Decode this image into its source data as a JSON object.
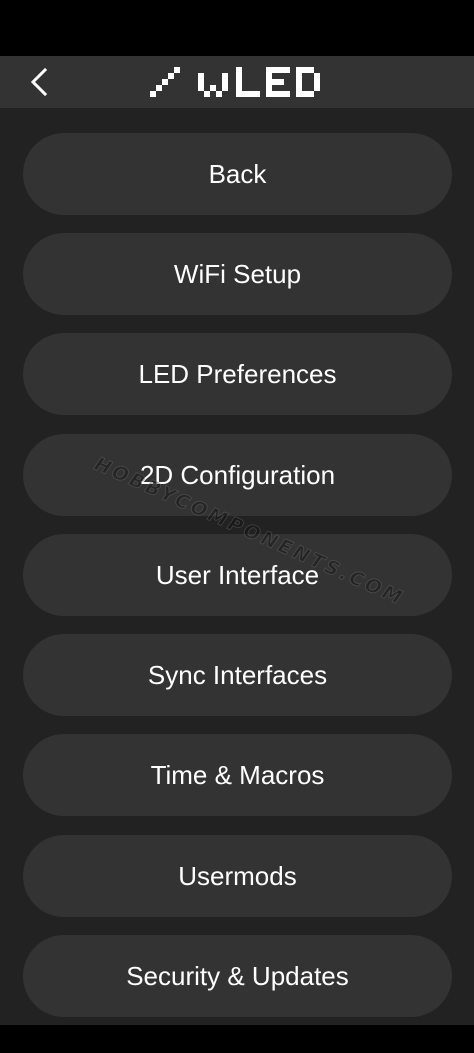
{
  "app": {
    "logo_text": "WLED",
    "back_icon": "chevron-left-icon",
    "accent_color": "#ffffff",
    "background_color": "#222222",
    "button_color": "#333333"
  },
  "menu": {
    "items": [
      {
        "label": "Back"
      },
      {
        "label": "WiFi Setup"
      },
      {
        "label": "LED Preferences"
      },
      {
        "label": "2D Configuration"
      },
      {
        "label": "User Interface"
      },
      {
        "label": "Sync Interfaces"
      },
      {
        "label": "Time & Macros"
      },
      {
        "label": "Usermods"
      },
      {
        "label": "Security & Updates"
      }
    ]
  },
  "watermark": {
    "text": "HOBBYCOMPONENTS.COM"
  }
}
